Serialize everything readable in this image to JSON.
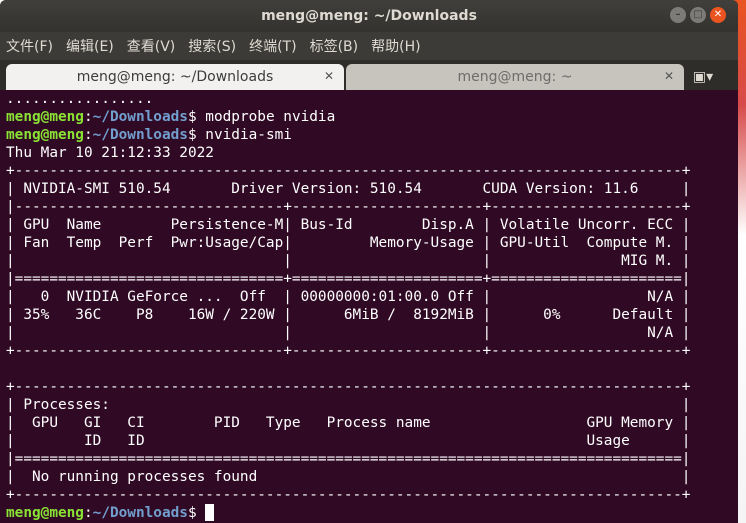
{
  "window": {
    "title": "meng@meng: ~/Downloads",
    "controls": [
      "minimize-icon",
      "maximize-icon",
      "close-icon"
    ]
  },
  "menu": [
    "文件(F)",
    "编辑(E)",
    "查看(V)",
    "搜索(S)",
    "终端(T)",
    "标签(B)",
    "帮助(H)"
  ],
  "tabs": [
    {
      "label": "meng@meng: ~/Downloads",
      "active": true
    },
    {
      "label": "meng@meng: ~",
      "active": false
    }
  ],
  "newtab_icon": "new-tab-icon",
  "colors": {
    "terminal_bg": "#300a24",
    "prompt_user": "#8ae234",
    "prompt_path": "#729fcf",
    "accent_close": "#e95420"
  },
  "prompt": {
    "user": "meng@meng",
    "sep": ":",
    "path": "~/Downloads",
    "dollar": "$"
  },
  "terminal": {
    "dots": ".................",
    "cmd1": " modprobe nvidia",
    "cmd2": " nvidia-smi",
    "lines": [
      "Thu Mar 10 21:12:33 2022",
      "+-----------------------------------------------------------------------------+",
      "| NVIDIA-SMI 510.54       Driver Version: 510.54       CUDA Version: 11.6     |",
      "|-------------------------------+----------------------+----------------------+",
      "| GPU  Name        Persistence-M| Bus-Id        Disp.A | Volatile Uncorr. ECC |",
      "| Fan  Temp  Perf  Pwr:Usage/Cap|         Memory-Usage | GPU-Util  Compute M. |",
      "|                               |                      |               MIG M. |",
      "|===============================+======================+======================|",
      "|   0  NVIDIA GeForce ...  Off  | 00000000:01:00.0 Off |                  N/A |",
      "| 35%   36C    P8    16W / 220W |      6MiB /  8192MiB |      0%      Default |",
      "|                               |                      |                  N/A |",
      "+-------------------------------+----------------------+----------------------+",
      "",
      "+-----------------------------------------------------------------------------+",
      "| Processes:                                                                  |",
      "|  GPU   GI   CI        PID   Type   Process name                  GPU Memory |",
      "|        ID   ID                                                   Usage      |",
      "|=============================================================================|",
      "|  No running processes found                                                 |",
      "+-----------------------------------------------------------------------------+"
    ]
  }
}
